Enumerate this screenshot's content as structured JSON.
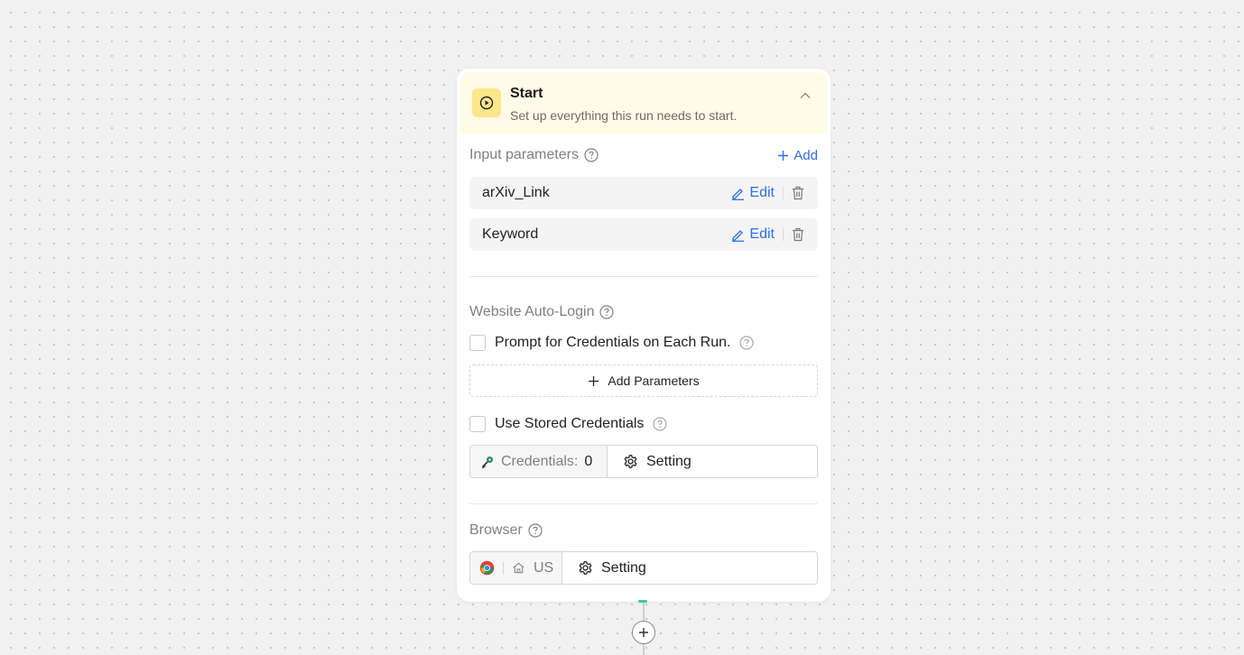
{
  "header": {
    "title": "Start",
    "subtitle": "Set up everything this run needs to start."
  },
  "input_parameters": {
    "label": "Input parameters",
    "add_label": "Add",
    "items": [
      {
        "name": "arXiv_Link",
        "edit_label": "Edit"
      },
      {
        "name": "Keyword",
        "edit_label": "Edit"
      }
    ]
  },
  "auto_login": {
    "label": "Website Auto-Login",
    "prompt_label": "Prompt for Credentials on Each Run.",
    "add_params_label": "Add Parameters",
    "stored_label": "Use Stored Credentials",
    "credentials_label": "Credentials:",
    "credentials_count": "0",
    "setting_label": "Setting"
  },
  "browser": {
    "label": "Browser",
    "region": "US",
    "setting_label": "Setting"
  },
  "colors": {
    "accent": "#2f6fe4",
    "header_bg": "#fffbe6",
    "start_icon_bg": "#fde68a",
    "connector": "#3ecf8e"
  },
  "icons": [
    "play-circle-icon",
    "chevron-up-icon",
    "help-circle-icon",
    "plus-icon",
    "pencil-icon",
    "trash-icon",
    "key-icon",
    "gear-icon",
    "chrome-icon",
    "home-icon",
    "plus-circle-icon"
  ]
}
